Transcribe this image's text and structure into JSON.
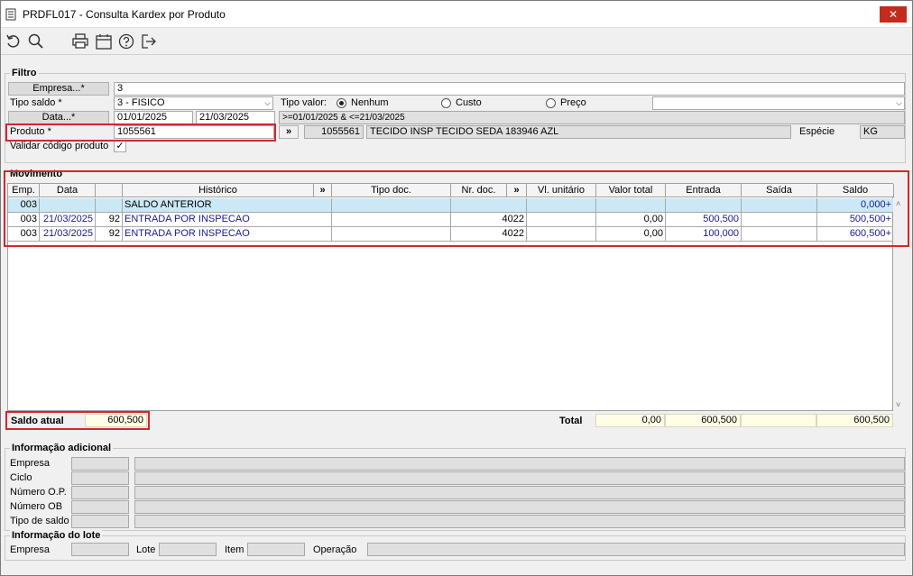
{
  "window": {
    "title": "PRDFL017 - Consulta Kardex por Produto",
    "close_glyph": "✕"
  },
  "toolbar": {
    "icons": [
      "refresh-icon",
      "search-icon",
      "print-icon",
      "calendar-icon",
      "help-icon",
      "exit-icon"
    ]
  },
  "filtro": {
    "group_title": "Filtro",
    "empresa_label": "Empresa...*",
    "empresa_value": "3",
    "tipo_saldo_label": "Tipo saldo *",
    "tipo_saldo_value": "3 - FISICO",
    "tipo_valor_label": "Tipo valor:",
    "radio_nenhum": "Nenhum",
    "radio_custo": "Custo",
    "radio_preco": "Preço",
    "data_label": "Data...*",
    "data_inicio": "01/01/2025",
    "data_fim": "21/03/2025",
    "data_expr": ">=01/01/2025 & <=21/03/2025",
    "produto_label": "Produto *",
    "produto_value": "1055561",
    "produto_btn": "»",
    "produto_codigo": "1055561",
    "produto_descricao": "TECIDO INSP TECIDO SEDA 183946 AZL",
    "especie_label": "Espécie",
    "especie_value": "KG",
    "validar_label": "Validar código produto",
    "validar_checked": "✓"
  },
  "movimento": {
    "group_title": "Movimento",
    "columns": {
      "emp": "Emp.",
      "data": "Data",
      "historico": "Histórico",
      "expand1": "»",
      "tipo_doc": "Tipo doc.",
      "nr_doc": "Nr. doc.",
      "expand2": "»",
      "vl_unitario": "Vl. unitário",
      "valor_total": "Valor total",
      "entrada": "Entrada",
      "saida": "Saída",
      "saldo": "Saldo"
    },
    "rows": [
      {
        "emp": "003",
        "data": "",
        "num": "",
        "historico": "SALDO ANTERIOR",
        "tipo_doc": "",
        "nr_doc": "",
        "vl_unitario": "",
        "valor_total": "",
        "entrada": "",
        "saida": "",
        "saldo": "0,000+"
      },
      {
        "emp": "003",
        "data": "21/03/2025",
        "num": "92",
        "historico": "ENTRADA POR INSPECAO",
        "tipo_doc": "",
        "nr_doc": "4022",
        "vl_unitario": "",
        "valor_total": "0,00",
        "entrada": "500,500",
        "saida": "",
        "saldo": "500,500+"
      },
      {
        "emp": "003",
        "data": "21/03/2025",
        "num": "92",
        "historico": "ENTRADA POR INSPECAO",
        "tipo_doc": "",
        "nr_doc": "4022",
        "vl_unitario": "",
        "valor_total": "0,00",
        "entrada": "100,000",
        "saida": "",
        "saldo": "600,500+"
      }
    ],
    "saldo_atual_label": "Saldo atual",
    "saldo_atual_value": "600,500",
    "total_label": "Total",
    "total_valor": "0,00",
    "total_entrada": "600,500",
    "total_saida": "",
    "total_saldo": "600,500"
  },
  "info_adicional": {
    "group_title": "Informação adicional",
    "labels": [
      "Empresa",
      "Ciclo",
      "Número O.P.",
      "Número OB",
      "Tipo de saldo"
    ]
  },
  "info_lote": {
    "group_title": "Informação do lote",
    "empresa_label": "Empresa",
    "lote_label": "Lote",
    "item_label": "Item",
    "operacao_label": "Operação"
  },
  "colors": {
    "highlight_red": "#d3262f",
    "selected_row": "#cbe8f6",
    "total_bg": "#fffde6",
    "text_blue": "#1a1a8c"
  }
}
